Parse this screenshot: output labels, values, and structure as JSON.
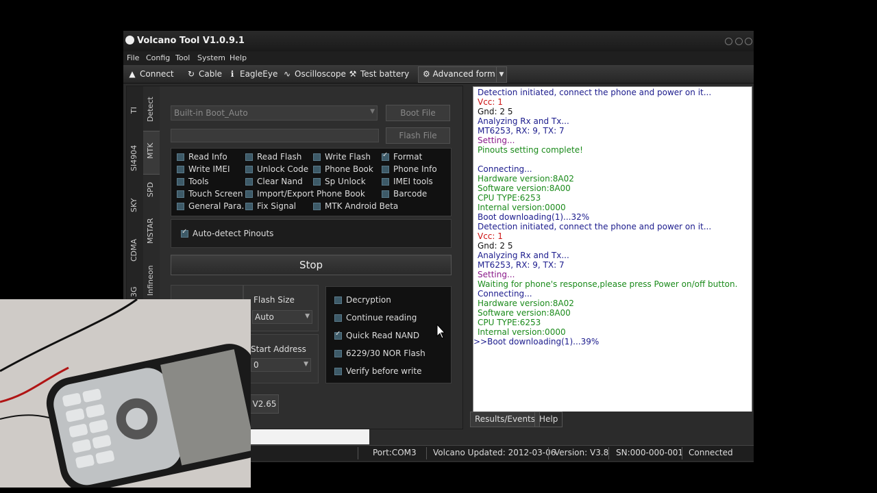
{
  "window": {
    "title": "Volcano Tool V1.0.9.1"
  },
  "menu": [
    "File",
    "Config",
    "Tool",
    "System",
    "Help"
  ],
  "toolbar": {
    "connect": "Connect",
    "cable": "Cable",
    "eagleeye": "EagleEye",
    "oscilloscope": "Oscilloscope",
    "test_battery": "Test battery",
    "advanced_form": "Advanced form"
  },
  "side_tabs": {
    "col1": [
      "TI",
      "SI4904",
      "SKY",
      "CDMA",
      "3G"
    ],
    "col2": [
      "Detect",
      "MTK",
      "SPD",
      "MSTAR",
      "Infineon"
    ]
  },
  "boot": {
    "combo_value": "Built-in Boot_Auto",
    "boot_file_button": "Boot File",
    "flash_file_button": "Flash File"
  },
  "functions": [
    {
      "label": "Read Info",
      "checked": false
    },
    {
      "label": "Read Flash",
      "checked": false
    },
    {
      "label": "Write Flash",
      "checked": false
    },
    {
      "label": "Format",
      "checked": true
    },
    {
      "label": "Write IMEI",
      "checked": false
    },
    {
      "label": "Unlock Code",
      "checked": false
    },
    {
      "label": "Phone Book",
      "checked": false
    },
    {
      "label": "Phone Info",
      "checked": false
    },
    {
      "label": "Tools",
      "checked": false
    },
    {
      "label": "Clear Nand",
      "checked": false
    },
    {
      "label": "Sp Unlock",
      "checked": false
    },
    {
      "label": "IMEI tools",
      "checked": false
    },
    {
      "label": "Touch Screen",
      "checked": false
    },
    {
      "label": "Import/Export Phone Book",
      "checked": false
    },
    {
      "label": "Barcode",
      "checked": false
    },
    {
      "label": "General Para.",
      "checked": false
    },
    {
      "label": "Fix Signal",
      "checked": false
    },
    {
      "label": "MTK Android Beta",
      "checked": false
    }
  ],
  "auto_detect": {
    "label": "Auto-detect Pinouts",
    "checked": true
  },
  "stop_button": "Stop",
  "flash_size": {
    "label": "Flash Size",
    "value": "Auto"
  },
  "start_address": {
    "label": "Start Address",
    "value": "0"
  },
  "version_button": "V2.65",
  "options": [
    {
      "label": "Decryption",
      "checked": false
    },
    {
      "label": "Continue reading",
      "checked": false
    },
    {
      "label": "Quick Read NAND",
      "checked": true
    },
    {
      "label": "6229/30 NOR Flash",
      "checked": false
    },
    {
      "label": "Verify before write",
      "checked": false
    }
  ],
  "log": [
    {
      "text": "Detection initiated, connect the phone and power on it...",
      "color": "#1a1a8c"
    },
    {
      "text": "Vcc: 1",
      "color": "#cc1111"
    },
    {
      "text": "Gnd: 2 5",
      "color": "#111111"
    },
    {
      "text": "Analyzing Rx and Tx...",
      "color": "#1a1a8c"
    },
    {
      "text": "MT6253, RX: 9, TX: 7",
      "color": "#1a1a8c"
    },
    {
      "text": "Setting...",
      "color": "#8a1a8a"
    },
    {
      "text": "Pinouts setting complete!",
      "color": "#1a8a1a"
    },
    {
      "text": "",
      "color": "#111111"
    },
    {
      "text": "Connecting...",
      "color": "#1a1a8c"
    },
    {
      "text": "Hardware version:8A02",
      "color": "#1a8a1a"
    },
    {
      "text": "Software version:8A00",
      "color": "#1a8a1a"
    },
    {
      "text": "CPU TYPE:6253",
      "color": "#1a8a1a"
    },
    {
      "text": "Internal version:0000",
      "color": "#1a8a1a"
    },
    {
      "text": "Boot downloading(1)...32%",
      "color": "#1a1a8c"
    },
    {
      "text": "Detection initiated, connect the phone and power on it...",
      "color": "#1a1a8c"
    },
    {
      "text": "Vcc: 1",
      "color": "#cc1111"
    },
    {
      "text": "Gnd: 2 5",
      "color": "#111111"
    },
    {
      "text": "Analyzing Rx and Tx...",
      "color": "#1a1a8c"
    },
    {
      "text": "MT6253, RX: 9, TX: 7",
      "color": "#1a1a8c"
    },
    {
      "text": "Setting...",
      "color": "#8a1a8a"
    },
    {
      "text": "Waiting for phone's response,please press Power on/off button.",
      "color": "#1a8a1a"
    },
    {
      "text": "Connecting...",
      "color": "#1a1a8c"
    },
    {
      "text": "Hardware version:8A02",
      "color": "#1a8a1a"
    },
    {
      "text": "Software version:8A00",
      "color": "#1a8a1a"
    },
    {
      "text": "CPU TYPE:6253",
      "color": "#1a8a1a"
    },
    {
      "text": "Internal version:0000",
      "color": "#1a8a1a"
    },
    {
      "text": ">>Boot downloading(1)...39%",
      "color": "#1a1a8c"
    }
  ],
  "log_tabs": [
    "Results/Events",
    "Help"
  ],
  "status": {
    "port": "Port:COM3",
    "updated": "Volcano Updated: 2012-03-06",
    "version": "Version: V3.8",
    "sn": "SN:000-000-001",
    "connection": "Connected"
  },
  "colors": {
    "window_bg": "#2b2b2b",
    "log_bg": "#ffffff",
    "checkbox": "#3d5a68"
  }
}
